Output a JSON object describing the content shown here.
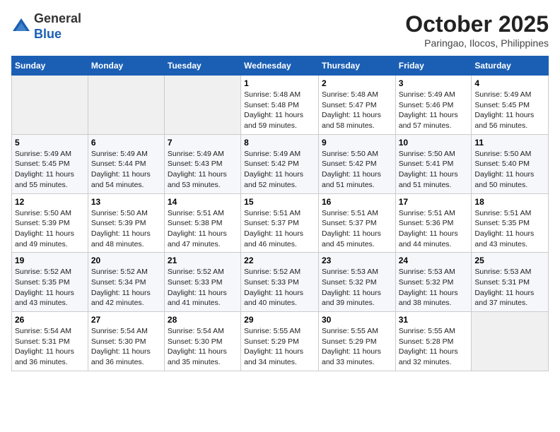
{
  "header": {
    "logo_line1": "General",
    "logo_line2": "Blue",
    "month": "October 2025",
    "location": "Paringao, Ilocos, Philippines"
  },
  "weekdays": [
    "Sunday",
    "Monday",
    "Tuesday",
    "Wednesday",
    "Thursday",
    "Friday",
    "Saturday"
  ],
  "weeks": [
    [
      {
        "day": "",
        "content": ""
      },
      {
        "day": "",
        "content": ""
      },
      {
        "day": "",
        "content": ""
      },
      {
        "day": "1",
        "content": "Sunrise: 5:48 AM\nSunset: 5:48 PM\nDaylight: 11 hours\nand 59 minutes."
      },
      {
        "day": "2",
        "content": "Sunrise: 5:48 AM\nSunset: 5:47 PM\nDaylight: 11 hours\nand 58 minutes."
      },
      {
        "day": "3",
        "content": "Sunrise: 5:49 AM\nSunset: 5:46 PM\nDaylight: 11 hours\nand 57 minutes."
      },
      {
        "day": "4",
        "content": "Sunrise: 5:49 AM\nSunset: 5:45 PM\nDaylight: 11 hours\nand 56 minutes."
      }
    ],
    [
      {
        "day": "5",
        "content": "Sunrise: 5:49 AM\nSunset: 5:45 PM\nDaylight: 11 hours\nand 55 minutes."
      },
      {
        "day": "6",
        "content": "Sunrise: 5:49 AM\nSunset: 5:44 PM\nDaylight: 11 hours\nand 54 minutes."
      },
      {
        "day": "7",
        "content": "Sunrise: 5:49 AM\nSunset: 5:43 PM\nDaylight: 11 hours\nand 53 minutes."
      },
      {
        "day": "8",
        "content": "Sunrise: 5:49 AM\nSunset: 5:42 PM\nDaylight: 11 hours\nand 52 minutes."
      },
      {
        "day": "9",
        "content": "Sunrise: 5:50 AM\nSunset: 5:42 PM\nDaylight: 11 hours\nand 51 minutes."
      },
      {
        "day": "10",
        "content": "Sunrise: 5:50 AM\nSunset: 5:41 PM\nDaylight: 11 hours\nand 51 minutes."
      },
      {
        "day": "11",
        "content": "Sunrise: 5:50 AM\nSunset: 5:40 PM\nDaylight: 11 hours\nand 50 minutes."
      }
    ],
    [
      {
        "day": "12",
        "content": "Sunrise: 5:50 AM\nSunset: 5:39 PM\nDaylight: 11 hours\nand 49 minutes."
      },
      {
        "day": "13",
        "content": "Sunrise: 5:50 AM\nSunset: 5:39 PM\nDaylight: 11 hours\nand 48 minutes."
      },
      {
        "day": "14",
        "content": "Sunrise: 5:51 AM\nSunset: 5:38 PM\nDaylight: 11 hours\nand 47 minutes."
      },
      {
        "day": "15",
        "content": "Sunrise: 5:51 AM\nSunset: 5:37 PM\nDaylight: 11 hours\nand 46 minutes."
      },
      {
        "day": "16",
        "content": "Sunrise: 5:51 AM\nSunset: 5:37 PM\nDaylight: 11 hours\nand 45 minutes."
      },
      {
        "day": "17",
        "content": "Sunrise: 5:51 AM\nSunset: 5:36 PM\nDaylight: 11 hours\nand 44 minutes."
      },
      {
        "day": "18",
        "content": "Sunrise: 5:51 AM\nSunset: 5:35 PM\nDaylight: 11 hours\nand 43 minutes."
      }
    ],
    [
      {
        "day": "19",
        "content": "Sunrise: 5:52 AM\nSunset: 5:35 PM\nDaylight: 11 hours\nand 43 minutes."
      },
      {
        "day": "20",
        "content": "Sunrise: 5:52 AM\nSunset: 5:34 PM\nDaylight: 11 hours\nand 42 minutes."
      },
      {
        "day": "21",
        "content": "Sunrise: 5:52 AM\nSunset: 5:33 PM\nDaylight: 11 hours\nand 41 minutes."
      },
      {
        "day": "22",
        "content": "Sunrise: 5:52 AM\nSunset: 5:33 PM\nDaylight: 11 hours\nand 40 minutes."
      },
      {
        "day": "23",
        "content": "Sunrise: 5:53 AM\nSunset: 5:32 PM\nDaylight: 11 hours\nand 39 minutes."
      },
      {
        "day": "24",
        "content": "Sunrise: 5:53 AM\nSunset: 5:32 PM\nDaylight: 11 hours\nand 38 minutes."
      },
      {
        "day": "25",
        "content": "Sunrise: 5:53 AM\nSunset: 5:31 PM\nDaylight: 11 hours\nand 37 minutes."
      }
    ],
    [
      {
        "day": "26",
        "content": "Sunrise: 5:54 AM\nSunset: 5:31 PM\nDaylight: 11 hours\nand 36 minutes."
      },
      {
        "day": "27",
        "content": "Sunrise: 5:54 AM\nSunset: 5:30 PM\nDaylight: 11 hours\nand 36 minutes."
      },
      {
        "day": "28",
        "content": "Sunrise: 5:54 AM\nSunset: 5:30 PM\nDaylight: 11 hours\nand 35 minutes."
      },
      {
        "day": "29",
        "content": "Sunrise: 5:55 AM\nSunset: 5:29 PM\nDaylight: 11 hours\nand 34 minutes."
      },
      {
        "day": "30",
        "content": "Sunrise: 5:55 AM\nSunset: 5:29 PM\nDaylight: 11 hours\nand 33 minutes."
      },
      {
        "day": "31",
        "content": "Sunrise: 5:55 AM\nSunset: 5:28 PM\nDaylight: 11 hours\nand 32 minutes."
      },
      {
        "day": "",
        "content": ""
      }
    ]
  ]
}
